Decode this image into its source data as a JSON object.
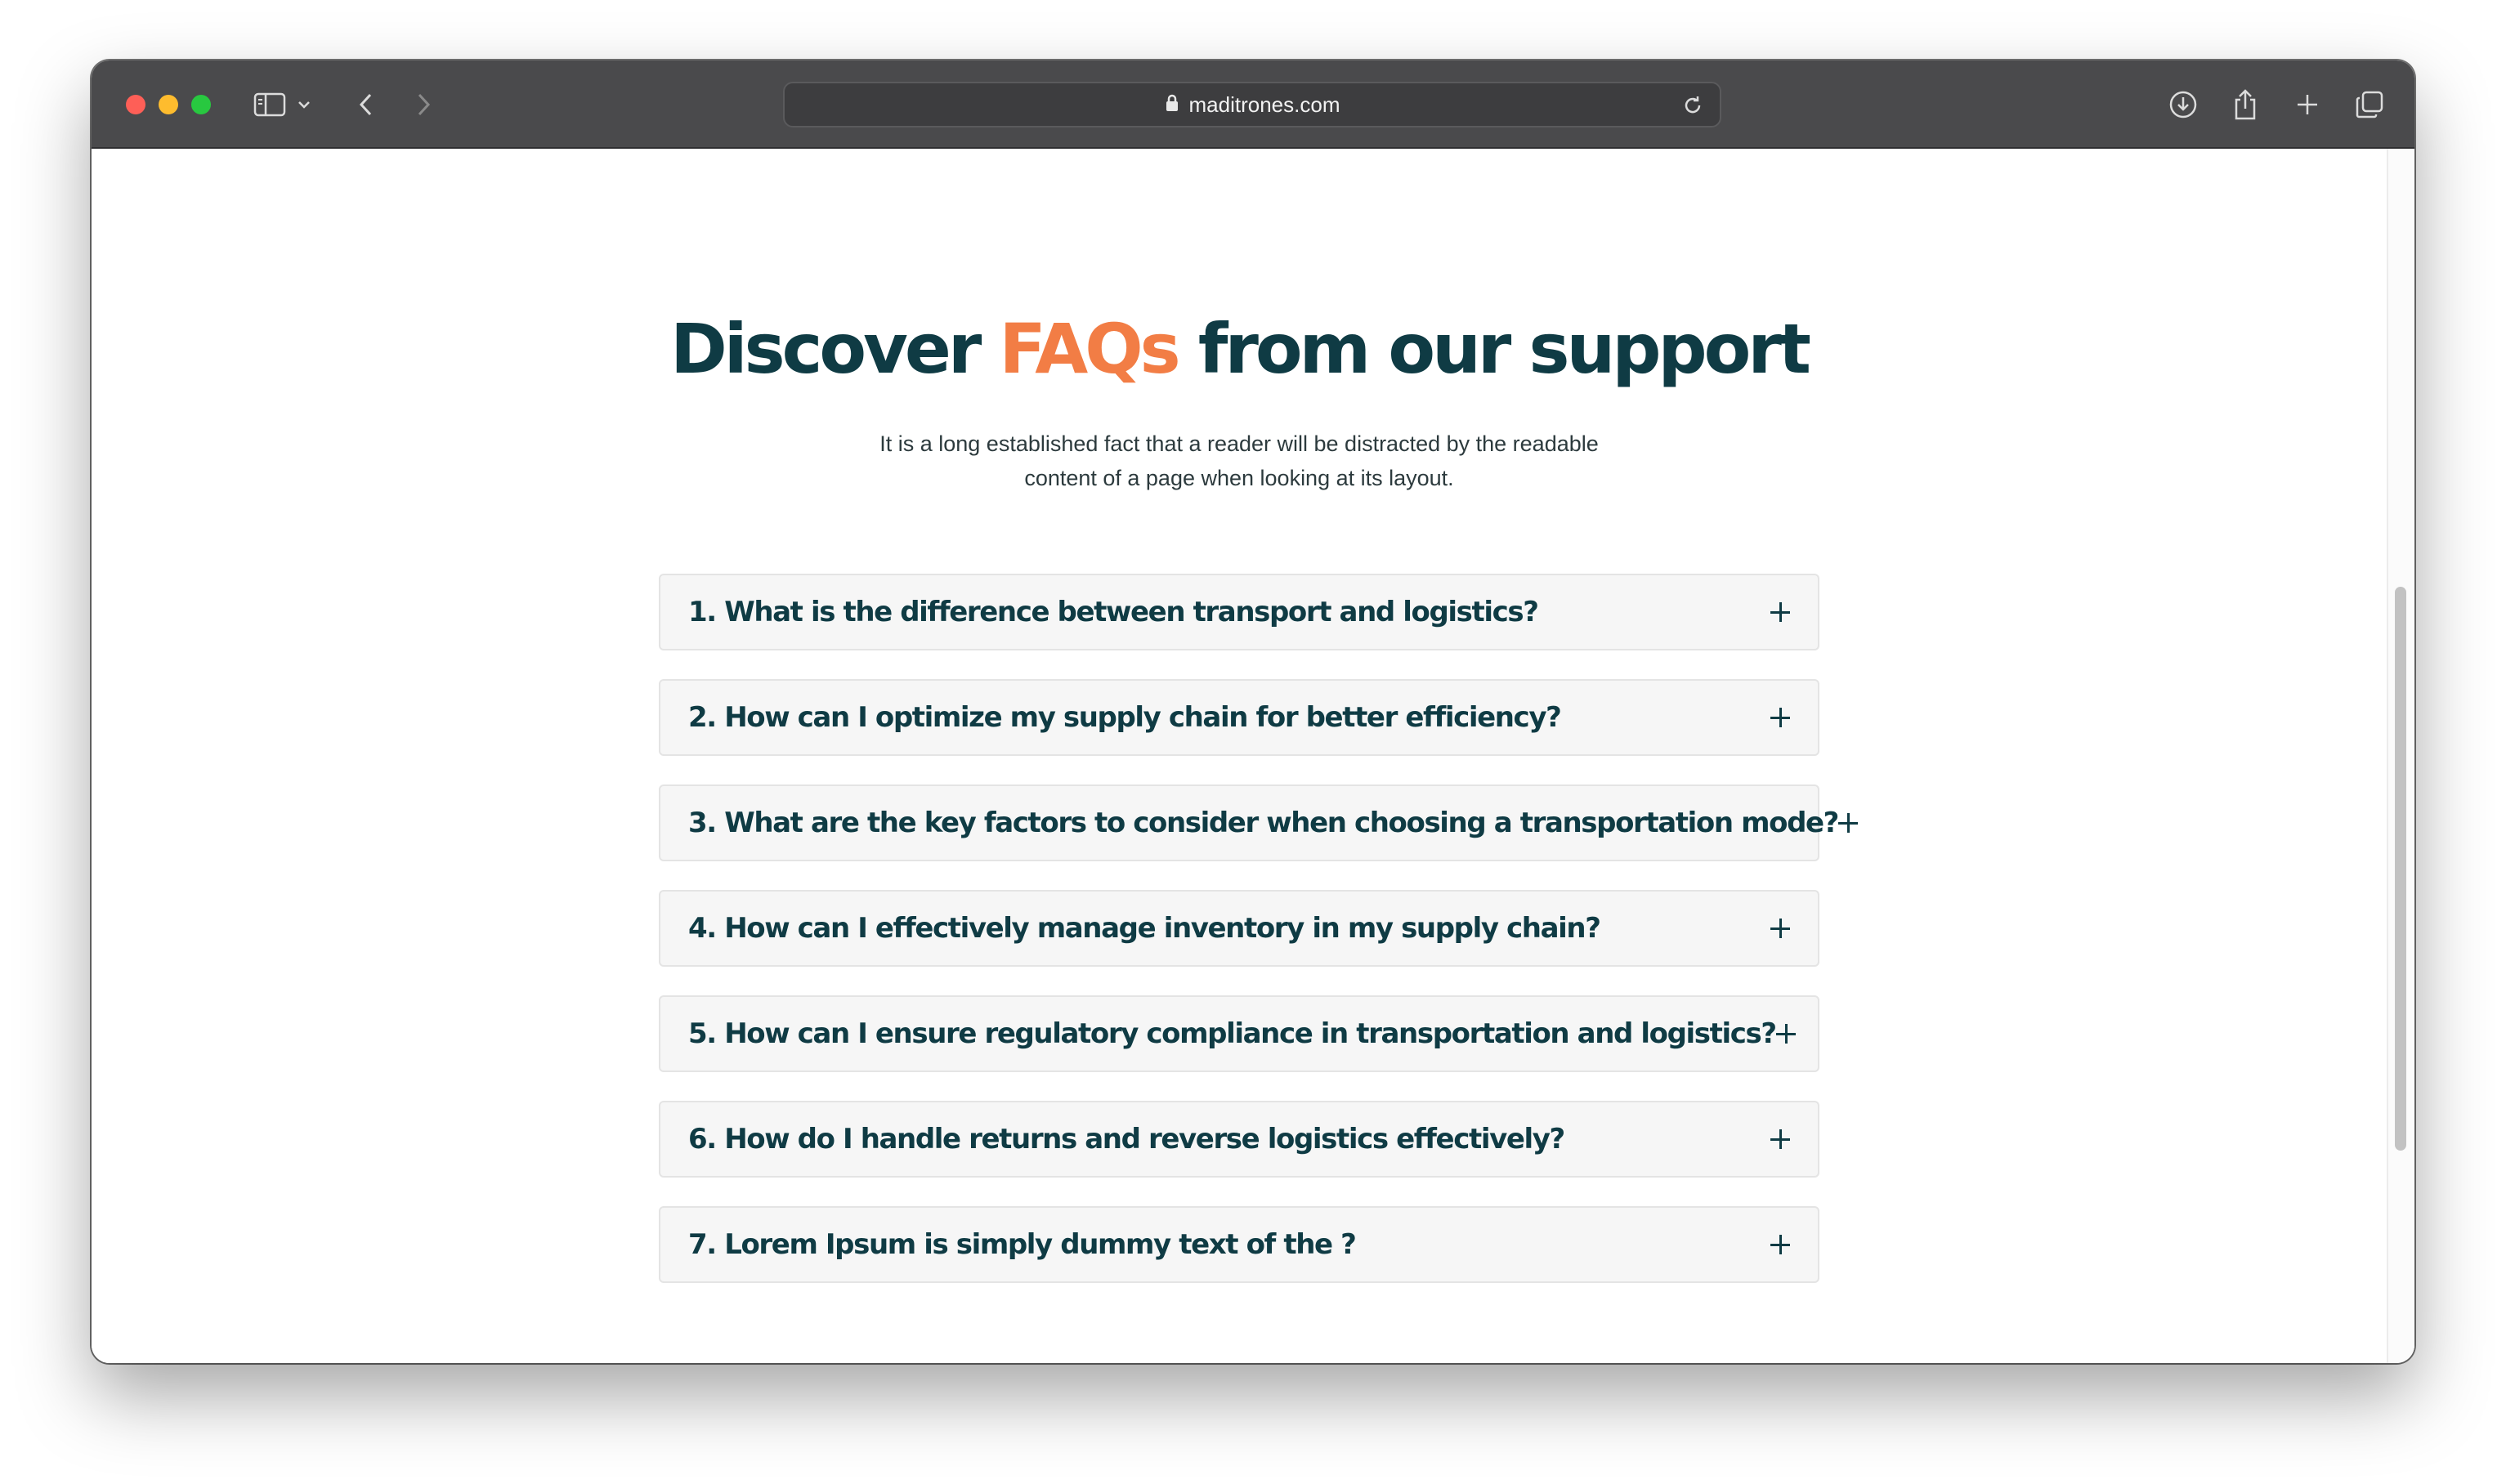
{
  "browser": {
    "url": "maditrones.com"
  },
  "page": {
    "heading_prefix": "Discover",
    "heading_accent": "FAQs",
    "heading_suffix": "from our support",
    "subtitle_line1": "It is a long established fact that a reader will be distracted by the readable",
    "subtitle_line2": "content of a page when looking at its layout."
  },
  "faqs": [
    {
      "question": "1. What is the difference between transport and logistics?"
    },
    {
      "question": "2. How can I optimize my supply chain for better efficiency?"
    },
    {
      "question": "3. What are the key factors to consider when choosing a transportation mode?"
    },
    {
      "question": "4. How can I effectively manage inventory in my supply chain?"
    },
    {
      "question": "5. How can I ensure regulatory compliance in transportation and logistics?"
    },
    {
      "question": "6. How do I handle returns and reverse logistics effectively?"
    },
    {
      "question": "7. Lorem Ipsum is simply dummy text of the ?"
    }
  ],
  "colors": {
    "heading": "#0f3b44",
    "accent": "#f27d45",
    "item_background": "#f6f6f6"
  },
  "icons": {
    "expand": "plus-icon"
  }
}
